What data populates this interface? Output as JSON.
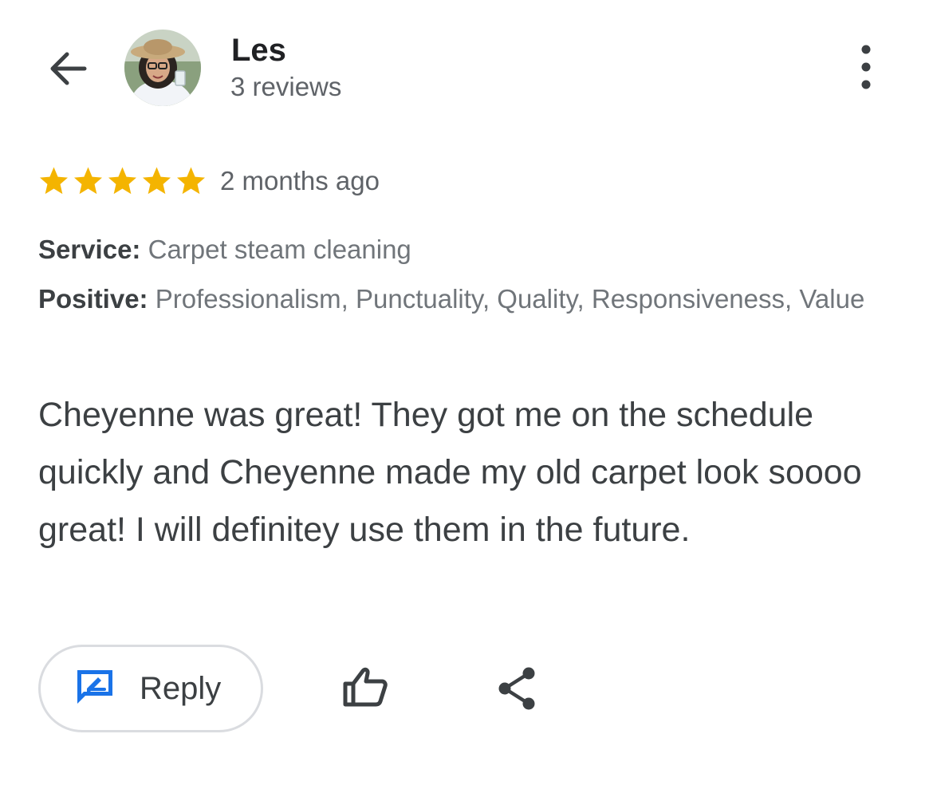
{
  "header": {
    "back_icon": "arrow-left-icon",
    "more_icon": "more-vertical-icon",
    "reviewer": {
      "name": "Les",
      "reviews_count": "3 reviews",
      "avatar": "profile-photo"
    }
  },
  "review": {
    "rating": 5,
    "rating_max": 5,
    "star_color": "#f4b400",
    "time_ago": "2 months ago",
    "service_label": "Service:",
    "service_value": "Carpet steam cleaning",
    "positive_label": "Positive:",
    "positive_value": "Professionalism, Punctuality, Quality, Responsiveness, Value",
    "body": "Cheyenne was great! They got me on the schedule quickly and Cheyenne made my old carpet look soooo great! I will definitey use them in the future."
  },
  "actions": {
    "reply_label": "Reply",
    "reply_icon": "reply-icon",
    "reply_icon_color": "#1a73e8",
    "like_icon": "thumbs-up-icon",
    "share_icon": "share-icon"
  }
}
